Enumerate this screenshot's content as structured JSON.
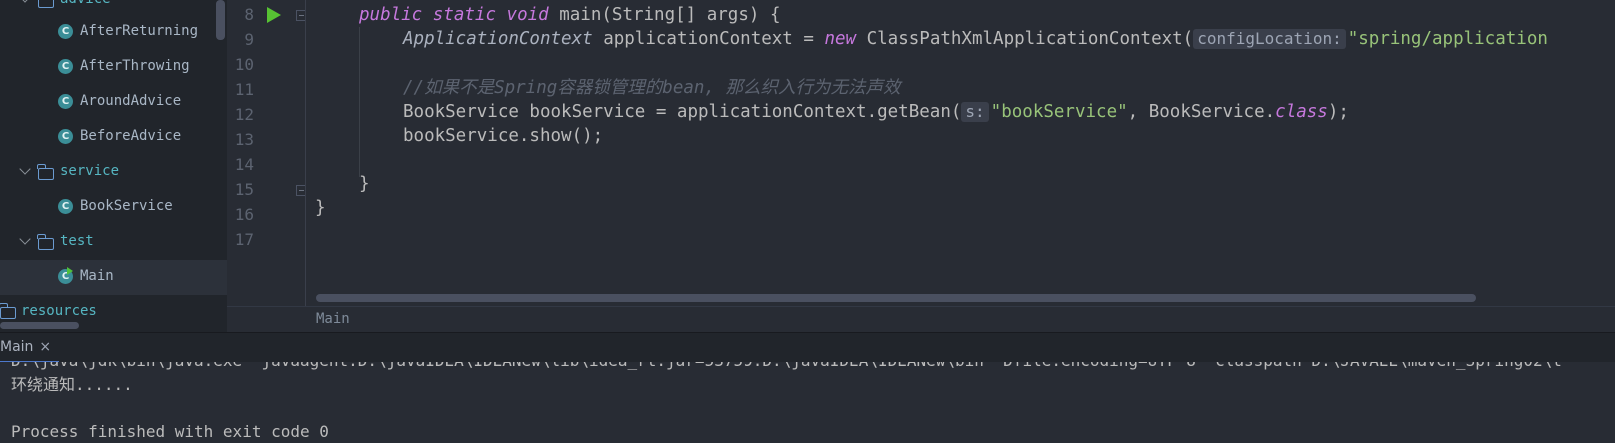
{
  "project_tree": {
    "items": [
      {
        "label": "advice",
        "kind": "folder",
        "expanded": true
      },
      {
        "label": "AfterReturning",
        "kind": "class"
      },
      {
        "label": "AfterThrowing",
        "kind": "class"
      },
      {
        "label": "AroundAdvice",
        "kind": "class"
      },
      {
        "label": "BeforeAdvice",
        "kind": "class"
      },
      {
        "label": "service",
        "kind": "folder",
        "expanded": true
      },
      {
        "label": "BookService",
        "kind": "class"
      },
      {
        "label": "test",
        "kind": "folder",
        "expanded": true
      },
      {
        "label": "Main",
        "kind": "class-runnable",
        "selected": true
      },
      {
        "label": "resources",
        "kind": "folder"
      }
    ],
    "class_icon_letter": "C"
  },
  "editor": {
    "line_numbers": [
      "8",
      "9",
      "10",
      "11",
      "12",
      "13",
      "14",
      "15",
      "16",
      "17"
    ],
    "code": {
      "l8_kw1": "public",
      "l8_kw2": "static",
      "l8_kw3": "void",
      "l8_rest": " main(String[] args) {",
      "l9_type": "ApplicationContext",
      "l9_mid": " applicationContext = ",
      "l9_new": "new",
      "l9_cls": " ClassPathXmlApplicationContext(",
      "l9_hint": "configLocation:",
      "l9_str": "\"spring/application",
      "l11_comment": "//如果不是Spring容器锁管理的bean, 那么织入行为无法声效",
      "l12_pre": "BookService bookService = applicationContext.getBean(",
      "l12_hint": "s:",
      "l12_str": "\"bookService\"",
      "l12_mid": ", BookService.",
      "l12_kw": "class",
      "l12_end": ");",
      "l13": "bookService.show();",
      "l15": "}",
      "l16": "}"
    }
  },
  "breadcrumb": {
    "label": "Main"
  },
  "run_panel": {
    "tab_label": "Main",
    "close_glyph": "×",
    "console": {
      "line1": "D:\\java\\jdk\\bin\\java.exe -javaagent:D:\\javaIDEA\\IDEANew\\lib\\idea_rt.jar=53759:D:\\javaIDEA\\IDEANew\\bin -Dfile.encoding=UTF-8 -classpath D:\\JAVAEE\\maven_Spring02\\t",
      "line2": "环绕通知......",
      "line3": "",
      "line4": "Process finished with exit code 0"
    }
  },
  "colors": {
    "keyword": "#c678dd",
    "string": "#98c379",
    "comment": "#5c6370",
    "folder_label": "#56b6c2",
    "run_green": "#57c233"
  }
}
